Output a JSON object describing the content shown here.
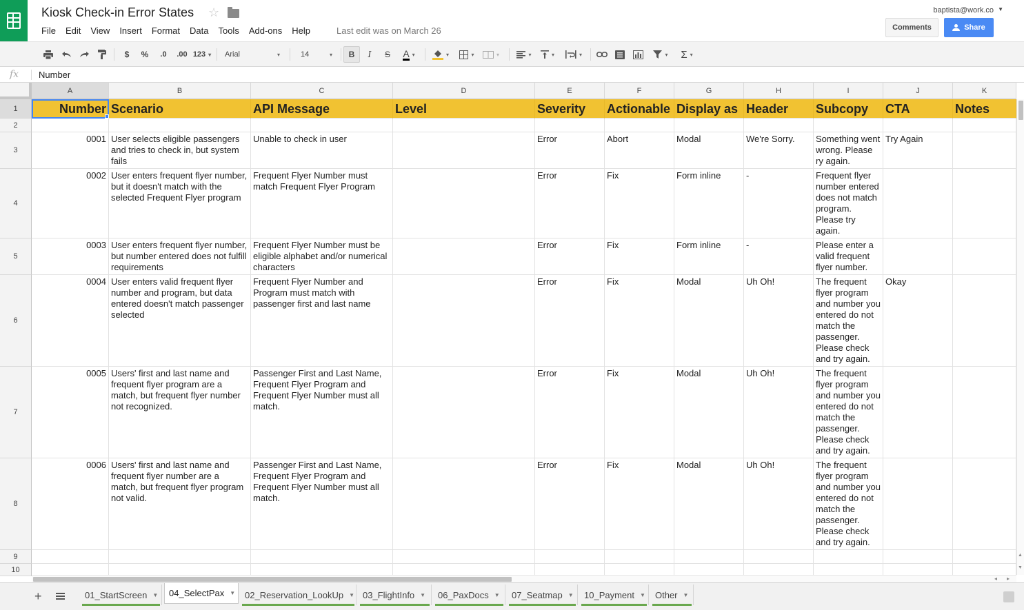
{
  "app": {
    "doc_title": "Kiosk Check-in Error States",
    "star_icon": "☆",
    "last_edit": "Last edit was on March 26",
    "user_email": "baptista@work.co",
    "comments_label": "Comments",
    "share_label": "Share",
    "brand_color": "#0f9d58",
    "share_color": "#4a8af4"
  },
  "menu": [
    "File",
    "Edit",
    "View",
    "Insert",
    "Format",
    "Data",
    "Tools",
    "Add-ons",
    "Help"
  ],
  "toolbar": {
    "currency": "$",
    "percent": "%",
    "decimal_decrease": ".0",
    "decimal_increase": ".00",
    "more_formats": "123",
    "font": "Arial",
    "font_size": "14",
    "bold": "B",
    "italic": "I",
    "strike": "S",
    "text_color": "A",
    "sum": "Σ"
  },
  "formula": {
    "fx": "fx",
    "value": "Number"
  },
  "columns": [
    "A",
    "B",
    "C",
    "D",
    "E",
    "F",
    "G",
    "H",
    "I",
    "J",
    "K"
  ],
  "rows": [
    "1",
    "2",
    "3",
    "4",
    "5",
    "6",
    "7",
    "8",
    "9",
    "10"
  ],
  "header_row": [
    "Number",
    "Scenario",
    "API Message",
    "Level",
    "Severity",
    "Actionable",
    "Display as",
    "Header",
    "Subcopy",
    "CTA",
    "Notes"
  ],
  "header_color": "#f1c232",
  "data_rows": [
    {
      "number": "0001",
      "scenario": "User selects eligible passengers and tries to check in, but system fails",
      "api_message": "Unable to check in user",
      "level": "",
      "severity": "Error",
      "actionable": "Abort",
      "display_as": "Modal",
      "header": "We're Sorry.",
      "subcopy": "Something went wrong. Please ry again.",
      "cta": "Try Again",
      "notes": ""
    },
    {
      "number": "0002",
      "scenario": "User enters frequent flyer number, but it doesn't match with the selected Frequent Flyer program",
      "api_message": "Frequent Flyer Number must match Frequent Flyer Program",
      "level": "",
      "severity": "Error",
      "actionable": "Fix",
      "display_as": "Form inline",
      "header": "-",
      "subcopy": "Frequent flyer number entered does not match program. Please try again.",
      "cta": "",
      "notes": ""
    },
    {
      "number": "0003",
      "scenario": "User enters frequent flyer number, but number entered does not fulfill requirements",
      "api_message": "Frequent Flyer Number must be eligible alphabet and/or numerical characters",
      "level": "",
      "severity": "Error",
      "actionable": "Fix",
      "display_as": "Form inline",
      "header": "-",
      "subcopy": "Please enter a valid frequent flyer number.",
      "cta": "",
      "notes": ""
    },
    {
      "number": "0004",
      "scenario": "User enters valid frequent flyer number and program, but data entered doesn't match passenger selected",
      "api_message": "Frequent Flyer Number and Program must match with passenger first and last name",
      "level": "",
      "severity": "Error",
      "actionable": "Fix",
      "display_as": "Modal",
      "header": "Uh Oh!",
      "subcopy": "The frequent flyer program and number you entered do not match the passenger. Please check and try again.",
      "cta": "Okay",
      "notes": ""
    },
    {
      "number": "0005",
      "scenario": "Users' first and last name and frequent flyer program are a match, but frequent flyer number not recognized.",
      "api_message": "Passenger First and Last Name, Frequent Flyer Program and Frequent Flyer Number must all match.",
      "level": "",
      "severity": "Error",
      "actionable": "Fix",
      "display_as": "Modal",
      "header": "Uh Oh!",
      "subcopy": "The frequent flyer program and number you entered do not match the passenger. Please check and try again.",
      "cta": "",
      "notes": ""
    },
    {
      "number": "0006",
      "scenario": "Users' first and last name and frequent flyer number are a match, but frequent flyer program not valid.",
      "api_message": "Passenger First and Last Name, Frequent Flyer Program and Frequent Flyer Number must all match.",
      "level": "",
      "severity": "Error",
      "actionable": "Fix",
      "display_as": "Modal",
      "header": "Uh Oh!",
      "subcopy": "The frequent flyer program and number you entered do not match the passenger. Please check and try again.",
      "cta": "",
      "notes": ""
    }
  ],
  "sheet_tabs": [
    {
      "label": "01_StartScreen",
      "active": false
    },
    {
      "label": "04_SelectPax",
      "active": true
    },
    {
      "label": "02_Reservation_LookUp",
      "active": false
    },
    {
      "label": "03_FlightInfo",
      "active": false
    },
    {
      "label": "06_PaxDocs",
      "active": false
    },
    {
      "label": "07_Seatmap",
      "active": false
    },
    {
      "label": "10_Payment",
      "active": false
    },
    {
      "label": "Other",
      "active": false
    }
  ],
  "tab_color": "#6aa84f"
}
